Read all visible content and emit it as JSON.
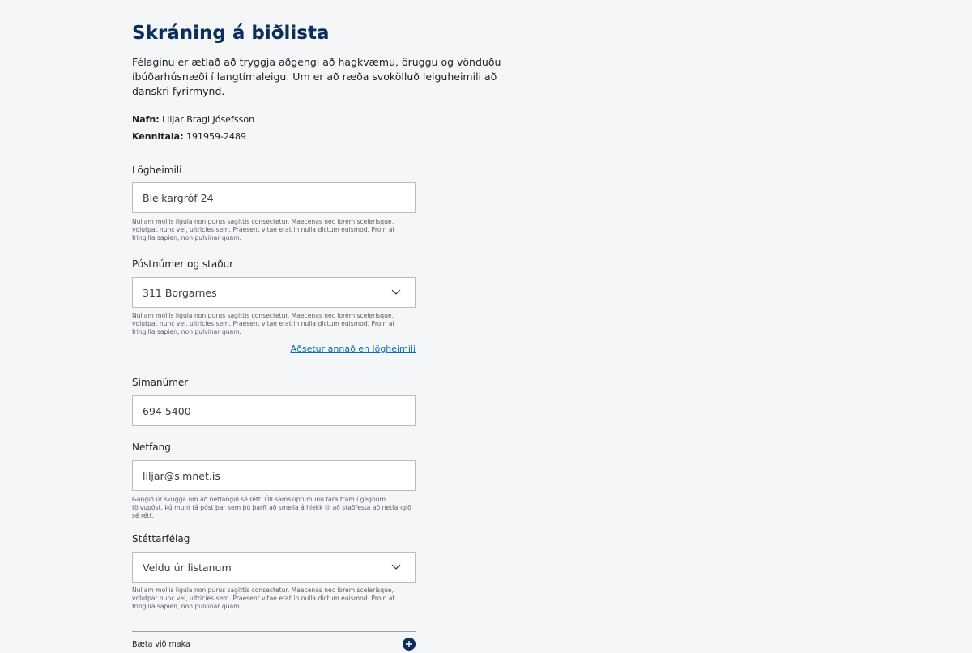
{
  "page": {
    "title": "Skráning á biðlista",
    "intro": "Félaginu er ætlað að tryggja aðgengi að hagkvæmu, öruggu og vönduðu íbúðarhúsnæði í langtímaleigu. Um er að ræða svokölluð leiguheimili að danskri fyrirmynd."
  },
  "applicant": {
    "name_label": "Nafn:",
    "name_value": "Liljar Bragi Jósefsson",
    "ssn_label": "Kennitala:",
    "ssn_value": "191959-2489"
  },
  "form": {
    "address": {
      "label": "Lögheimili",
      "value": "Bleikargróf 24",
      "help": "Nullam mollis ligula non purus sagittis consectetur. Maecenas nec lorem scelerisque, volutpat nunc vel, ultricies sem. Praesent vitae erat in nulla dictum euismod. Proin at fringilla sapien, non pulvinar quam."
    },
    "postal": {
      "label": "Póstnúmer og staður",
      "value": "311 Borgarnes",
      "help": "Nullam mollis ligula non purus sagittis consectetur. Maecenas nec lorem scelerisque, volutpat nunc vel, ultricies sem. Praesent vitae erat in nulla dictum euismod. Proin at fringilla sapien, non pulvinar quam.",
      "link": "Aðsetur annað en lögheimili"
    },
    "phone": {
      "label": "Símanúmer",
      "value": "694 5400"
    },
    "email": {
      "label": "Netfang",
      "value": "liljar@simnet.is",
      "help": "Gangið úr skugga um að netfangið sé rétt. Öll samskipti munu fara fram í gegnum tölvupóst. Þú munt fá póst þar sem þú þarft að smella á hlekk til að staðfesta að netfangið sé rétt."
    },
    "union": {
      "label": "Stéttarfélag",
      "value": "Veldu úr listanum",
      "help": "Nullam mollis ligula non purus sagittis consectetur. Maecenas nec lorem scelerisque, volutpat nunc vel, ultricies sem. Praesent vitae erat in nulla dictum euismod. Proin at fringilla sapien, non pulvinar quam."
    },
    "spouse": {
      "label": "Bæta við maka"
    }
  },
  "icons": {
    "dropdown": "chevron-down-icon",
    "add": "plus-circle-icon"
  },
  "colors": {
    "heading": "#0b2f5a",
    "link": "#0a6fb8",
    "background": "#f5f6f8"
  }
}
